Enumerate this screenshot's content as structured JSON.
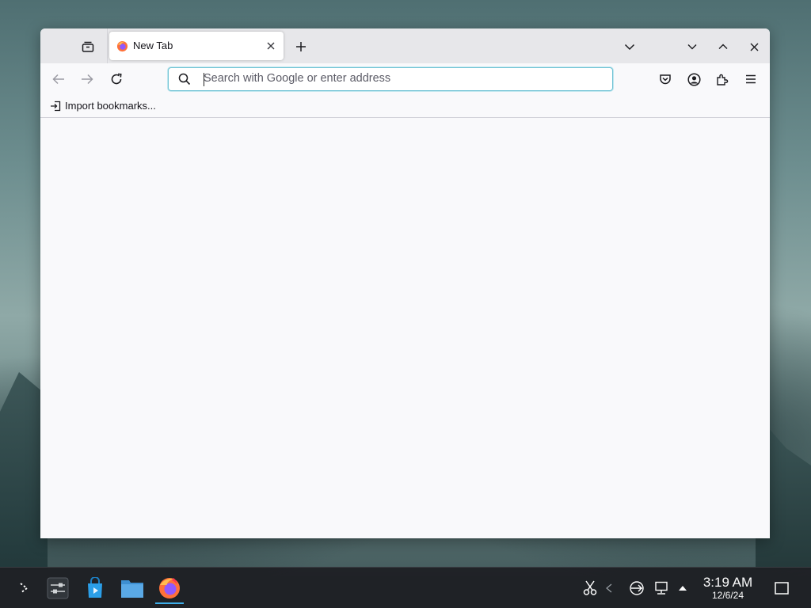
{
  "browser": {
    "tab": {
      "title": "New Tab"
    },
    "urlbar": {
      "placeholder": "Search with Google or enter address",
      "value": ""
    },
    "bookmarks": {
      "import_label": "Import bookmarks..."
    }
  },
  "taskbar": {
    "time": "3:19 AM",
    "date": "12/6/24"
  },
  "icons": {
    "tab_overview": "tab-overview-icon",
    "new_tab": "plus-icon",
    "list_all_tabs": "chevron-down-icon",
    "minimize": "chevron-down-icon",
    "maximize": "chevron-up-icon",
    "close_window": "close-icon",
    "back": "arrow-left-icon",
    "forward": "arrow-right-icon",
    "reload": "reload-icon",
    "pocket": "pocket-icon",
    "account": "account-icon",
    "extensions": "puzzle-icon",
    "menu": "hamburger-menu-icon"
  },
  "colors": {
    "accent": "#6fc2d4",
    "firefox_orange": "#ff7139",
    "taskbar_bg": "#1e2024"
  }
}
